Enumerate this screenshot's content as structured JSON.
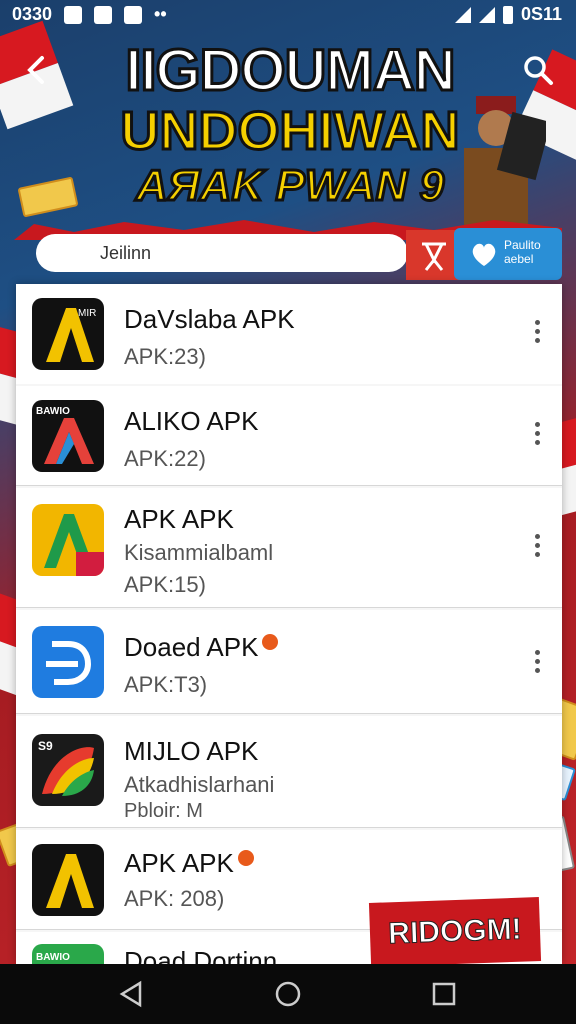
{
  "status_bar": {
    "time": "0330",
    "right_text": "0S11"
  },
  "header": {
    "banner_line1": "IIGDOUMAN",
    "banner_line2": "UNDOHIWAN",
    "banner_line3": "AЯAK PWAN 9",
    "back_icon": "back-arrow-icon",
    "search_icon": "search-icon"
  },
  "search": {
    "value": "Jeilinn"
  },
  "promo": {
    "label_line1": "Paulito",
    "label_line2": "aebel"
  },
  "apps": [
    {
      "name": "DaVslaba APK",
      "meta": "APK:23)",
      "extra": "",
      "icon_letter": "A",
      "icon_label": "MIR",
      "badge": false
    },
    {
      "name": "ALIKO APK",
      "meta": "APK:22)",
      "extra": "",
      "icon_letter": "A",
      "icon_label": "BAWIO",
      "badge": false
    },
    {
      "name": "APK APK",
      "meta": "APK:15)",
      "extra": "Kisammialbaml",
      "icon_letter": "A",
      "icon_label": "",
      "badge": false
    },
    {
      "name": "Doaed APK",
      "meta": "APK:T3)",
      "extra": "",
      "icon_letter": "D",
      "icon_label": "",
      "badge": true
    },
    {
      "name": "MIJLO APK",
      "meta": "Pbloir: M",
      "extra": "Atkadhislarhani",
      "icon_letter": "",
      "icon_label": "S9",
      "badge": false
    },
    {
      "name": "APK APK",
      "meta": "APK: 208)",
      "extra": "",
      "icon_letter": "A",
      "icon_label": "",
      "badge": true
    },
    {
      "name": "Doad Dortinn",
      "meta": "",
      "extra": "",
      "icon_letter": "",
      "icon_label": "BAWIO",
      "badge": false
    }
  ],
  "ribbon": {
    "text": "RIDOGM!"
  },
  "colors": {
    "accent_red": "#d9372b",
    "promo_blue": "#2a8fd6",
    "banner_yellow": "#f5d000"
  }
}
